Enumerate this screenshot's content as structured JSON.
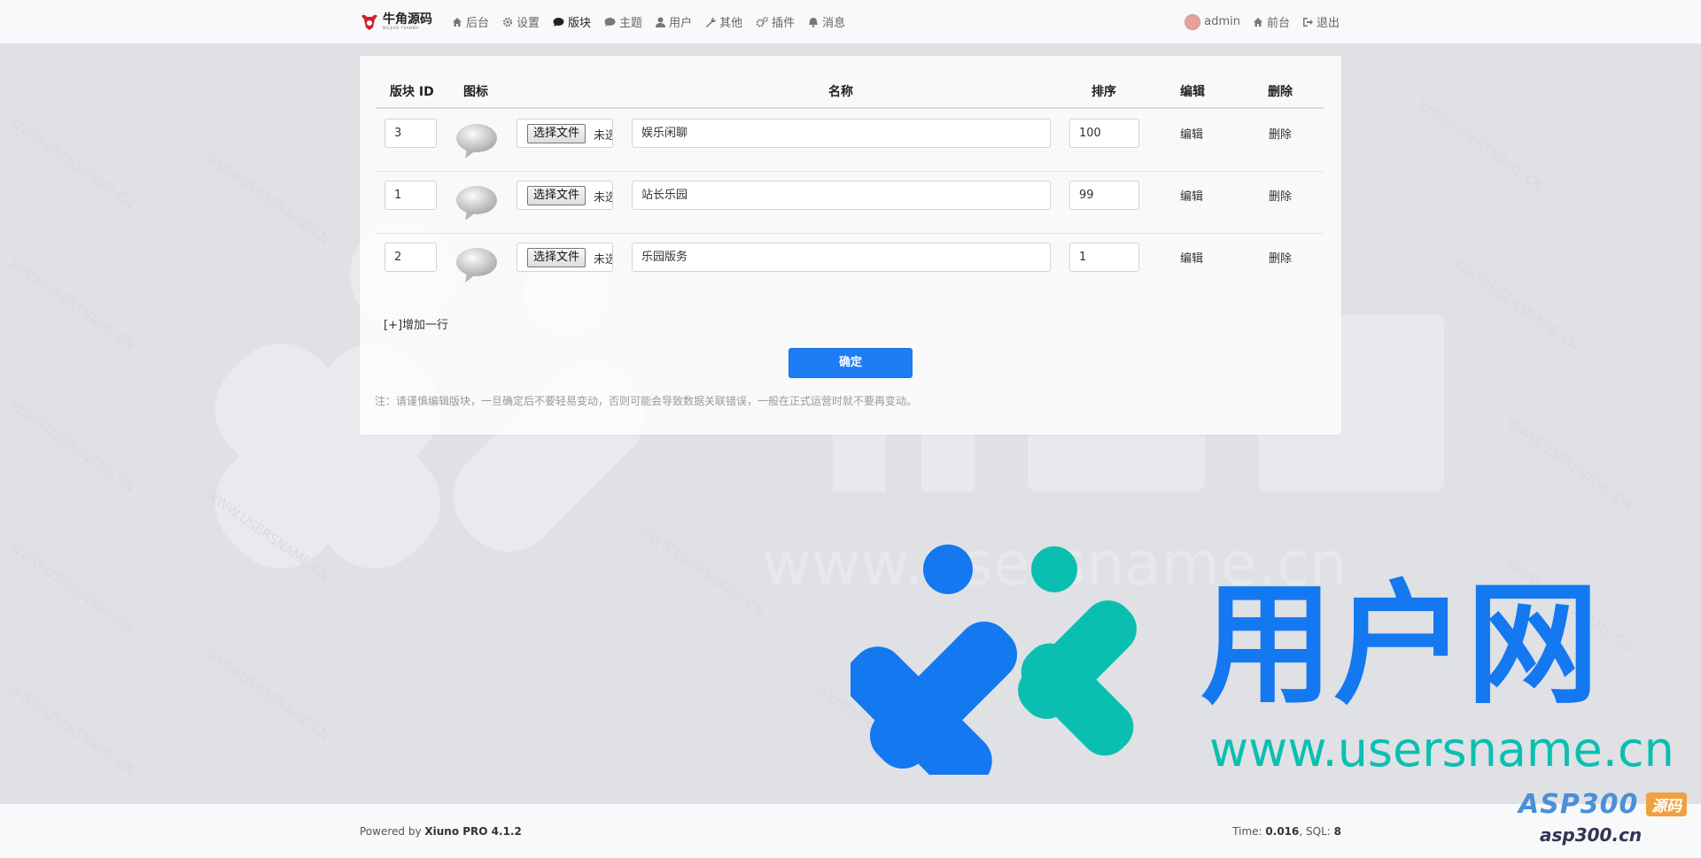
{
  "brand": {
    "name": "牛角源码",
    "sub": "NIUJIAO YUANMA"
  },
  "nav": {
    "items": [
      {
        "label": "后台"
      },
      {
        "label": "设置"
      },
      {
        "label": "版块"
      },
      {
        "label": "主题"
      },
      {
        "label": "用户"
      },
      {
        "label": "其他"
      },
      {
        "label": "插件"
      },
      {
        "label": "消息"
      }
    ],
    "user": "admin",
    "front": "前台",
    "logout": "退出"
  },
  "table": {
    "headers": {
      "id": "版块 ID",
      "icon": "图标",
      "name": "名称",
      "rank": "排序",
      "edit": "编辑",
      "delete": "删除"
    },
    "file_button": "选择文件",
    "file_status": "未选择任何文件",
    "rows": [
      {
        "id": "3",
        "name": "娱乐闲聊",
        "rank": "100",
        "edit": "编辑",
        "delete": "删除"
      },
      {
        "id": "1",
        "name": "站长乐园",
        "rank": "99",
        "edit": "编辑",
        "delete": "删除"
      },
      {
        "id": "2",
        "name": "乐园版务",
        "rank": "1",
        "edit": "编辑",
        "delete": "删除"
      }
    ],
    "add_row": "[+]增加一行",
    "submit": "确定",
    "note": "注：请谨慎编辑版块，一旦确定后不要轻易变动，否则可能会导致数据关联错误，一般在正式运营时就不要再变动。"
  },
  "footer": {
    "powered_prefix": "Powered by",
    "powered_product": "Xiuno PRO 4.1.2",
    "time_label": "Time:",
    "time_value": "0.016",
    "sql_label": ", SQL:",
    "sql_value": "8"
  },
  "watermark": {
    "brand": "用户网",
    "url": "www.usersname.cn",
    "tile_text": "WWW.USERSNAME.CN",
    "corner_logo": "ASP300",
    "corner_tag": "源码",
    "corner_url": "asp300.cn"
  },
  "colors": {
    "primary": "#1e7cf5",
    "watermark_blue": "#1478f0",
    "watermark_teal": "#0bbfb0"
  }
}
